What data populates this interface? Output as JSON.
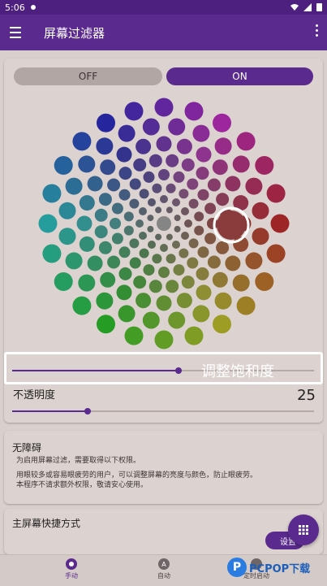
{
  "status_bar": {
    "time": "5:06"
  },
  "app_bar": {
    "title": "屏幕过滤器"
  },
  "toggle": {
    "off_label": "OFF",
    "on_label": "ON"
  },
  "color_wheel": {
    "selected_color": "#8a3c3c"
  },
  "saturation": {
    "label": "调整饱和度",
    "value": 0.55
  },
  "opacity": {
    "label": "不透明度",
    "value": "25",
    "fraction": 0.25
  },
  "permissions": {
    "title": "无障碍",
    "line1": "为启用屏幕过滤，需要取得以下权限。",
    "line2": "用眼较多或容易眼疲劳的用户，可以调整屏幕的亮度与颜色，防止眼疲劳。",
    "line3": "本程序不请求额外权限，敬请安心使用。"
  },
  "shortcut": {
    "title": "主屏幕快捷方式",
    "button_label": "设置"
  },
  "bottom_nav": {
    "manual": {
      "label": "手动",
      "icon_letter": ""
    },
    "auto": {
      "label": "自动",
      "icon_letter": "A"
    },
    "scheduled": {
      "label": "定时启动"
    }
  },
  "watermark": {
    "text": "PCPOP下载",
    "letter": "P"
  },
  "colors": {
    "primary": "#5b2a8f",
    "statusbar": "#4d1f7e",
    "background": "#d9cfcc"
  }
}
